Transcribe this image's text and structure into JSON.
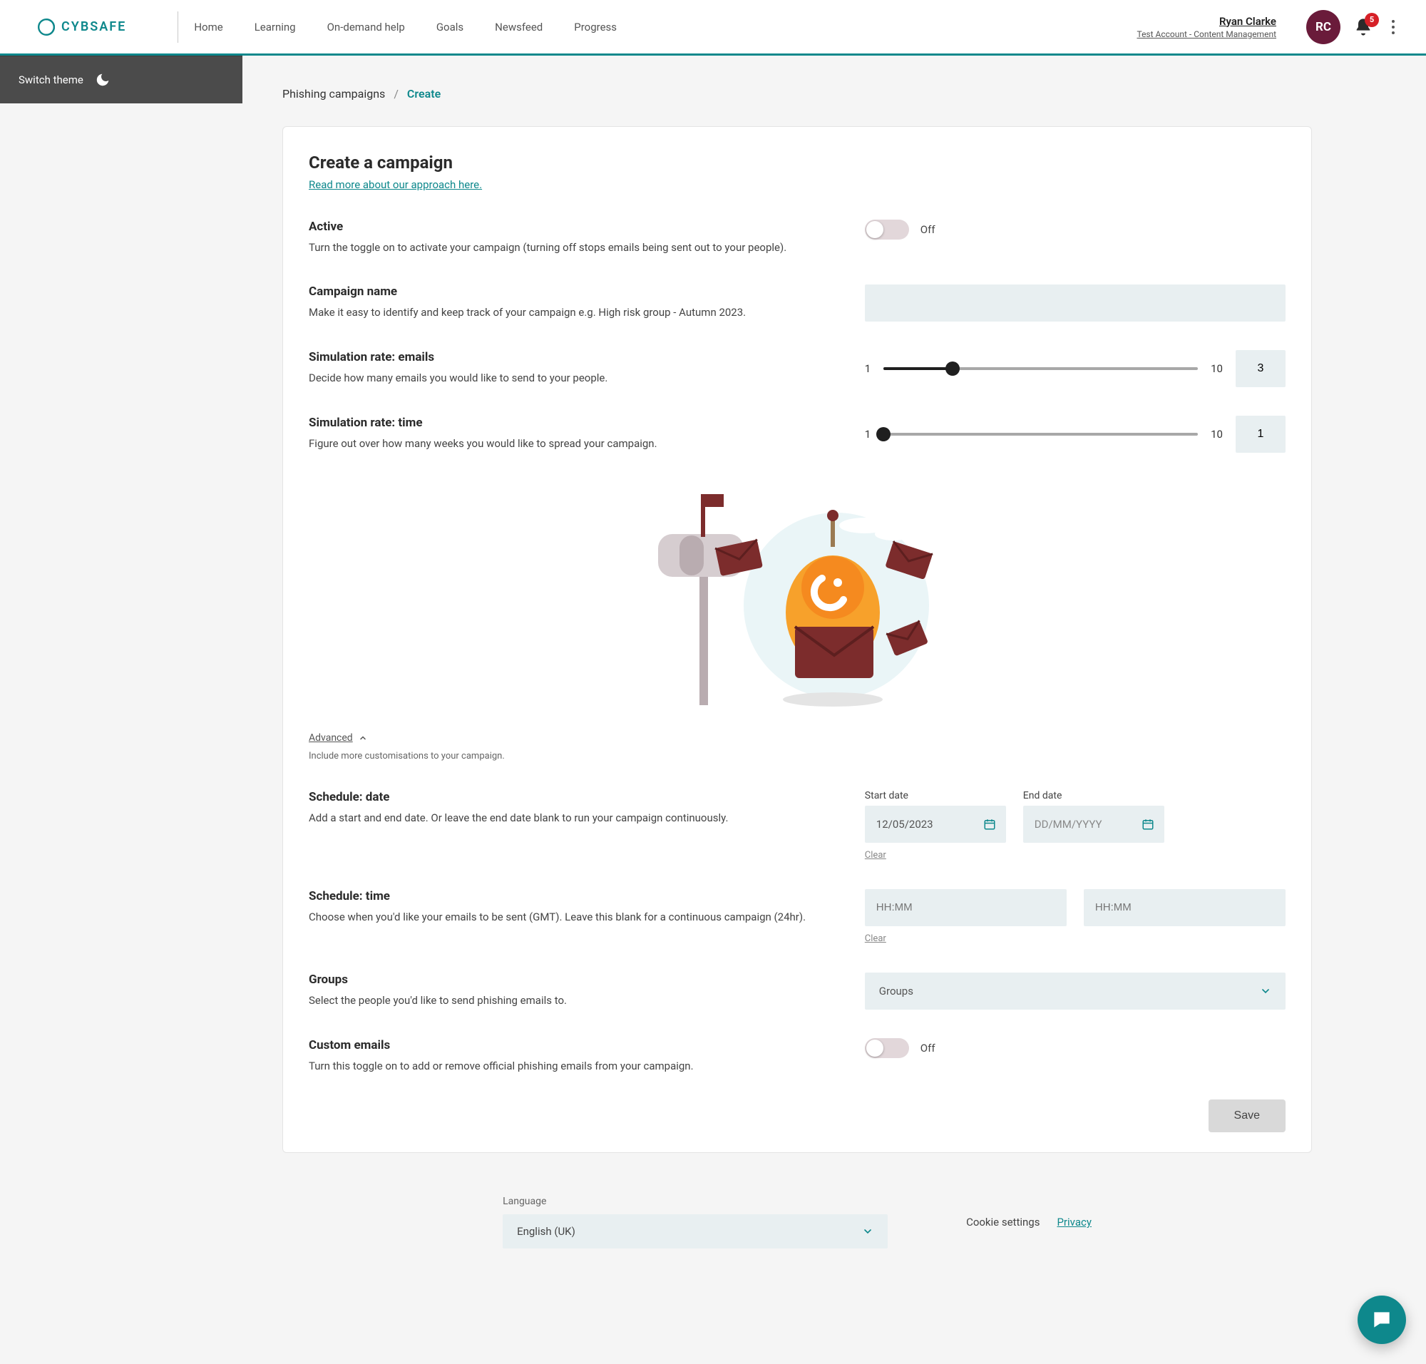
{
  "brand": {
    "name": "CYBSAFE"
  },
  "nav": {
    "items": [
      "Home",
      "Learning",
      "On-demand help",
      "Goals",
      "Newsfeed",
      "Progress"
    ]
  },
  "user": {
    "name": "Ryan Clarke",
    "account": "Test Account - Content Management",
    "initials": "RC",
    "notifications": "5"
  },
  "sidebar": {
    "switch_theme": "Switch theme"
  },
  "breadcrumb": {
    "root": "Phishing campaigns",
    "sep": "/",
    "current": "Create"
  },
  "card": {
    "title": "Create a campaign",
    "help": "Read more about our approach here.",
    "active": {
      "label": "Active",
      "desc": "Turn the toggle on to activate your campaign (turning off stops emails being sent out to your people).",
      "state": "Off"
    },
    "name": {
      "label": "Campaign name",
      "desc": "Make it easy to identify and keep track of your campaign e.g. High risk group - Autumn 2023."
    },
    "rate_emails": {
      "label": "Simulation rate: emails",
      "desc": "Decide how many emails you would like to send to your people.",
      "min": "1",
      "max": "10",
      "value": "3",
      "pct": 22
    },
    "rate_time": {
      "label": "Simulation rate: time",
      "desc": "Figure out over how many weeks you would like to spread your campaign.",
      "min": "1",
      "max": "10",
      "value": "1",
      "pct": 0
    },
    "advanced": {
      "label": "Advanced",
      "caption": "Include more customisations to your campaign."
    },
    "schedule_date": {
      "label": "Schedule: date",
      "desc": "Add a start and end date. Or leave the end date blank to run your campaign continuously.",
      "start_label": "Start date",
      "end_label": "End date",
      "start_value": "12/05/2023",
      "end_placeholder": "DD/MM/YYYY",
      "clear": "Clear"
    },
    "schedule_time": {
      "label": "Schedule: time",
      "desc": "Choose when you'd like your emails to be sent (GMT). Leave this blank for a continuous campaign (24hr).",
      "placeholder": "HH:MM",
      "clear": "Clear"
    },
    "groups": {
      "label": "Groups",
      "desc": "Select the people you'd like to send phishing emails to.",
      "placeholder": "Groups"
    },
    "custom": {
      "label": "Custom emails",
      "desc": "Turn this toggle on to add or remove official phishing emails from your campaign.",
      "state": "Off"
    },
    "save": "Save"
  },
  "footer": {
    "language_label": "Language",
    "language_value": "English (UK)",
    "cookie": "Cookie settings",
    "privacy": "Privacy"
  }
}
